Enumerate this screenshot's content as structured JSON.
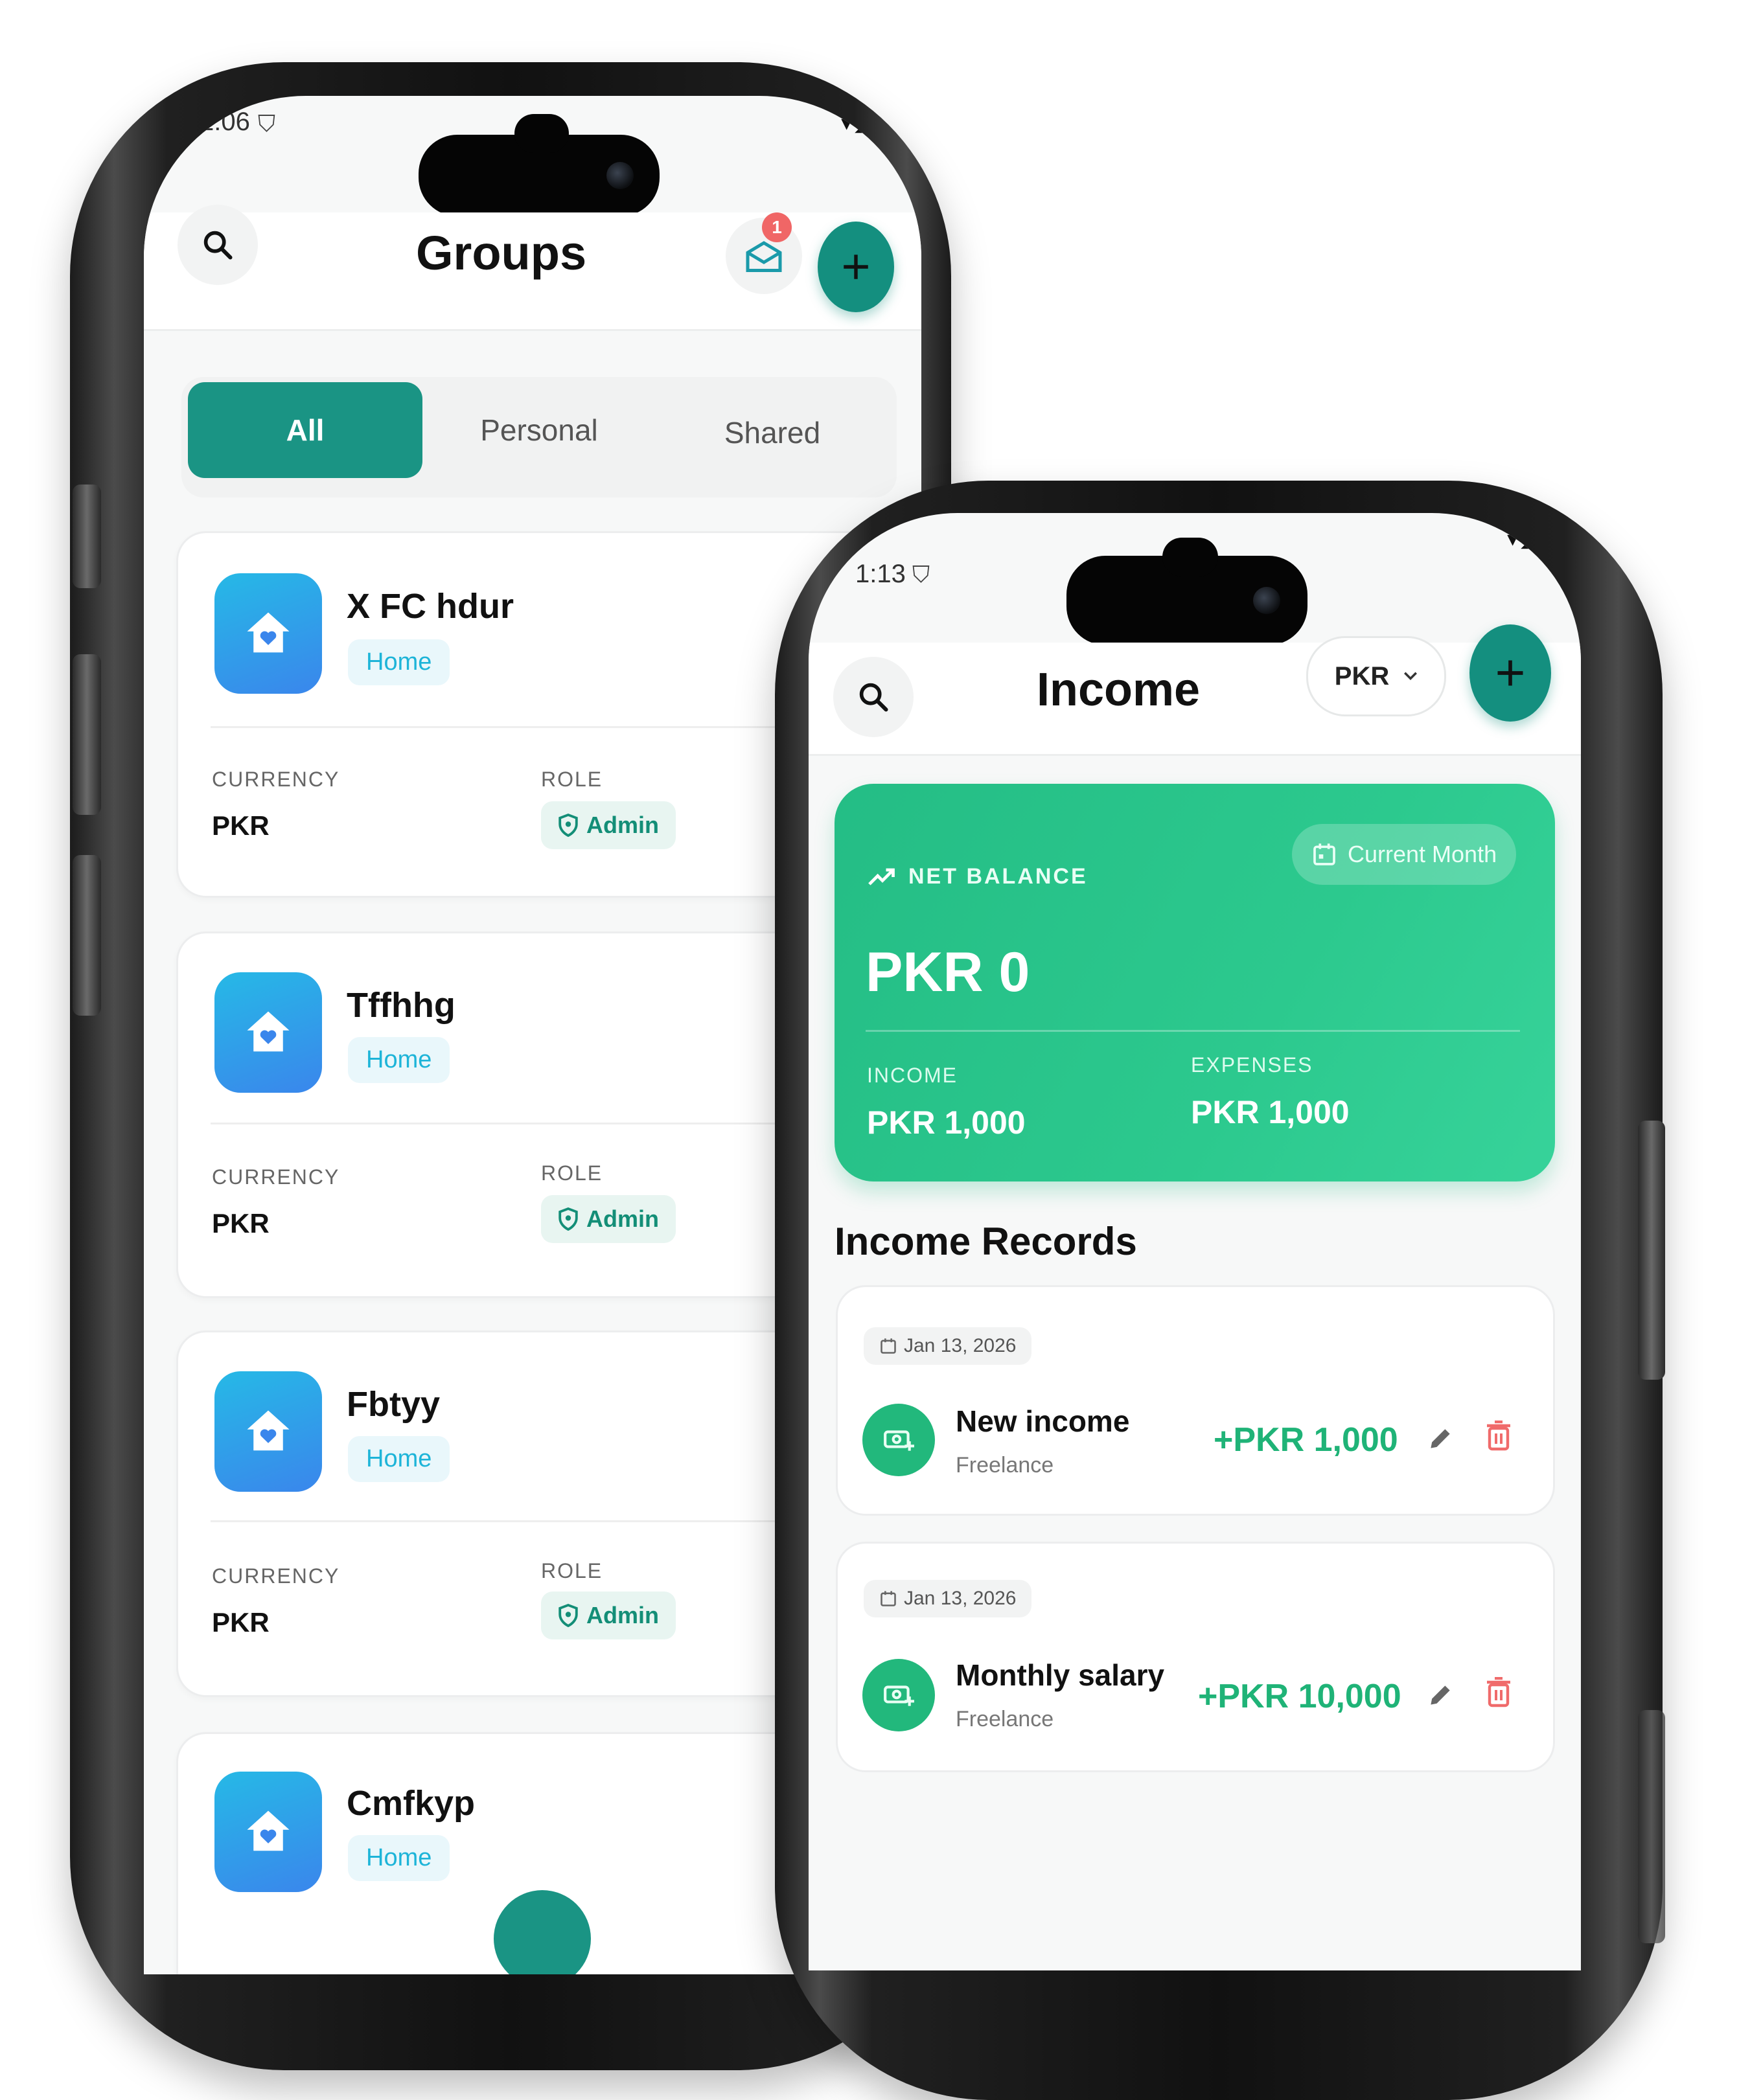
{
  "groups_screen": {
    "status": {
      "time": "1:06"
    },
    "title": "Groups",
    "notification_count": "1",
    "tabs": [
      {
        "label": "All",
        "active": true
      },
      {
        "label": "Personal",
        "active": false
      },
      {
        "label": "Shared",
        "active": false
      }
    ],
    "groups": [
      {
        "name": "X FC hdur",
        "type": "Home",
        "currency_label": "CURRENCY",
        "currency": "PKR",
        "role_label": "ROLE",
        "role": "Admin"
      },
      {
        "name": "Tffhhg",
        "type": "Home",
        "currency_label": "CURRENCY",
        "currency": "PKR",
        "role_label": "ROLE",
        "role": "Admin"
      },
      {
        "name": "Fbtyy",
        "type": "Home",
        "currency_label": "CURRENCY",
        "currency": "PKR",
        "role_label": "ROLE",
        "role": "Admin"
      },
      {
        "name": "Cmfkyp",
        "type": "Home"
      }
    ]
  },
  "income_screen": {
    "status": {
      "time": "1:13"
    },
    "title": "Income",
    "currency_select": "PKR",
    "balance": {
      "label": "NET BALANCE",
      "period": "Current Month",
      "amount": "PKR 0",
      "income_label": "INCOME",
      "income": "PKR 1,000",
      "expenses_label": "EXPENSES",
      "expenses": "PKR 1,000"
    },
    "records_title": "Income Records",
    "records": [
      {
        "date": "Jan 13, 2026",
        "title": "New income",
        "category": "Freelance",
        "amount": "+PKR 1,000"
      },
      {
        "date": "Jan 13, 2026",
        "title": "Monthly salary",
        "category": "Freelance",
        "amount": "+PKR 10,000"
      }
    ]
  },
  "colors": {
    "brand_teal": "#148f7f",
    "income_green": "#24bd85",
    "home_icon_blue": "#3a86ec",
    "delete_red": "#f06b6b"
  }
}
